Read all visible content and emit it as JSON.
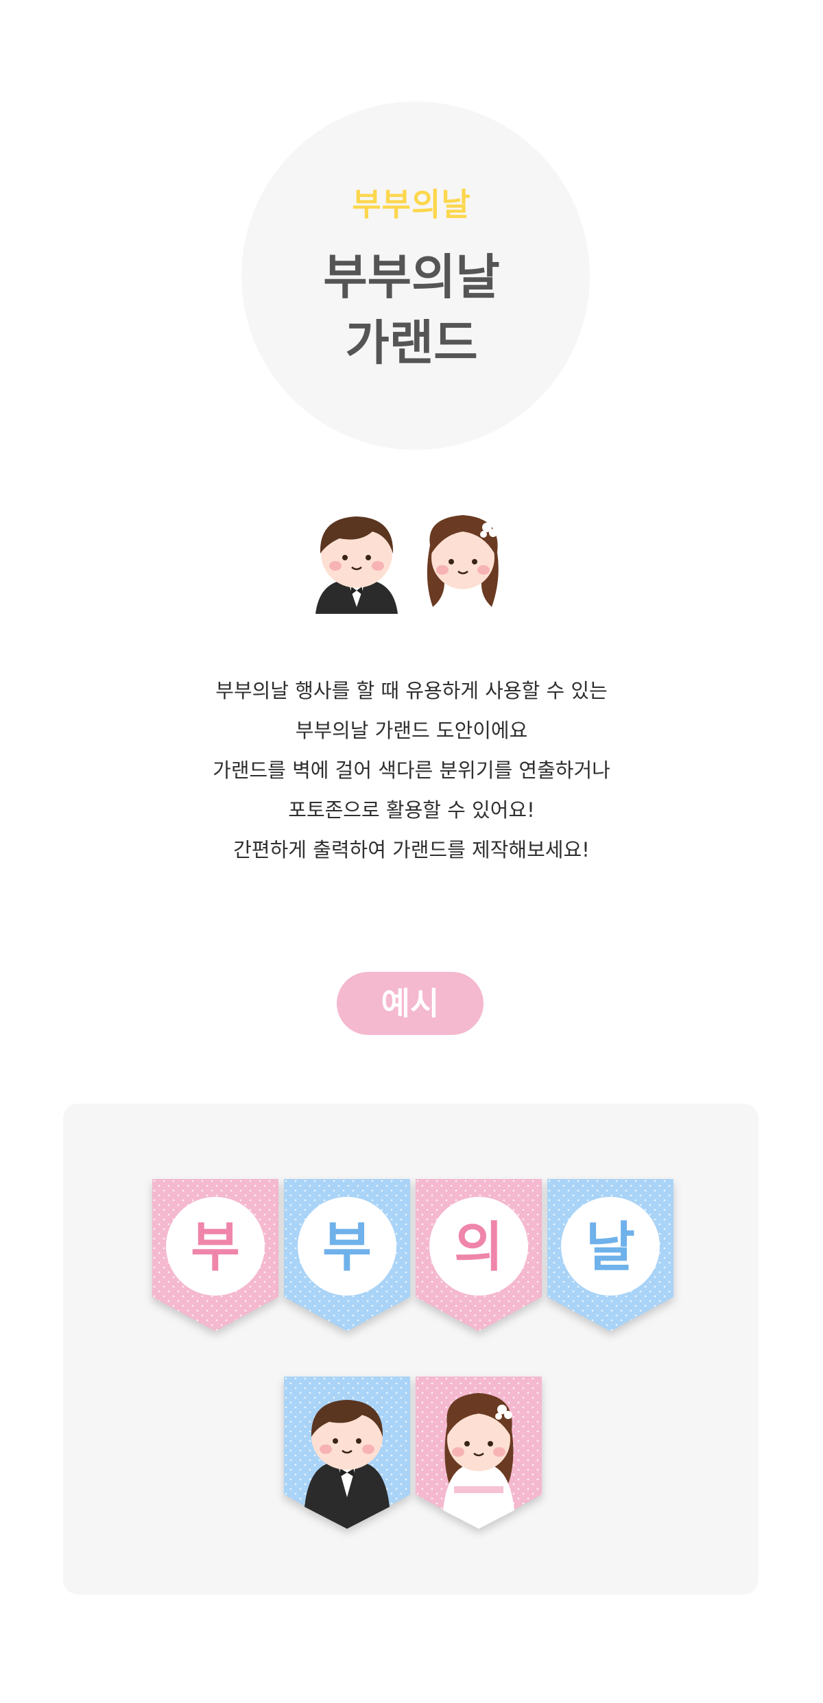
{
  "hero": {
    "kicker": "부부의날",
    "title_line1": "부부의날",
    "title_line2": "가랜드"
  },
  "description": [
    "부부의날 행사를 할 때 유용하게 사용할 수 있는",
    "부부의날 가랜드 도안이에요",
    "가랜드를 벽에 걸어 색다른 분위기를 연출하거나",
    "포토존으로 활용할 수 있어요!",
    "간편하게 출력하여 가랜드를 제작해보세요!"
  ],
  "example_button": "예시",
  "garland": {
    "letter_flags": [
      {
        "letter": "부",
        "flag_color": "#f4b8cf",
        "letter_color": "#ef85aa"
      },
      {
        "letter": "부",
        "flag_color": "#a9d3f7",
        "letter_color": "#6fb1ea"
      },
      {
        "letter": "의",
        "flag_color": "#f4b8cf",
        "letter_color": "#ef85aa"
      },
      {
        "letter": "날",
        "flag_color": "#a9d3f7",
        "letter_color": "#6fb1ea"
      }
    ],
    "character_flags": [
      {
        "character": "groom",
        "flag_color": "#a9d3f7"
      },
      {
        "character": "bride",
        "flag_color": "#f4b8cf"
      }
    ]
  },
  "colors": {
    "accent_yellow": "#fcd74e",
    "pink": "#f4b8cf",
    "blue": "#a9d3f7",
    "title_gray": "#555555"
  }
}
